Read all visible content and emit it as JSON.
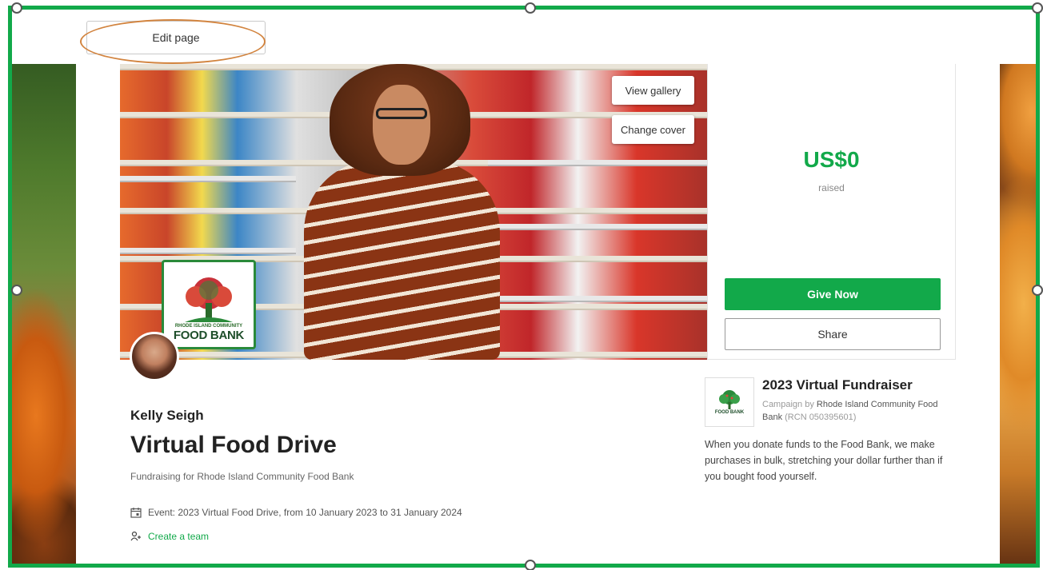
{
  "toolbar": {
    "edit_page_label": "Edit page"
  },
  "cover": {
    "view_gallery_label": "View gallery",
    "change_cover_label": "Change cover",
    "logo_caption": "RHODE ISLAND COMMUNITY",
    "logo_word": "FOOD BANK"
  },
  "fundraiser": {
    "organizer": "Kelly Seigh",
    "title": "Virtual Food Drive",
    "subtitle": "Fundraising for Rhode Island Community Food Bank",
    "event_text": "Event: 2023 Virtual Food Drive, from 10 January 2023 to 31 January 2024",
    "create_team_label": "Create a team"
  },
  "donation": {
    "amount_raised": "US$0",
    "raised_label": "raised",
    "give_now_label": "Give Now",
    "share_label": "Share"
  },
  "campaign": {
    "title": "2023 Virtual Fundraiser",
    "by_prefix": "Campaign by",
    "by_org": "Rhode Island Community Food Bank",
    "rcn": "(RCN 050395601)",
    "logo_word": "FOOD BANK",
    "description": "When you donate funds to the Food Bank, we make purchases in bulk, stretching your dollar further than if you bought food yourself."
  },
  "colors": {
    "brand_green": "#12a94a",
    "highlight_oval": "#d2843f"
  },
  "icons": {
    "event": "calendar-icon",
    "team": "team-icon"
  }
}
